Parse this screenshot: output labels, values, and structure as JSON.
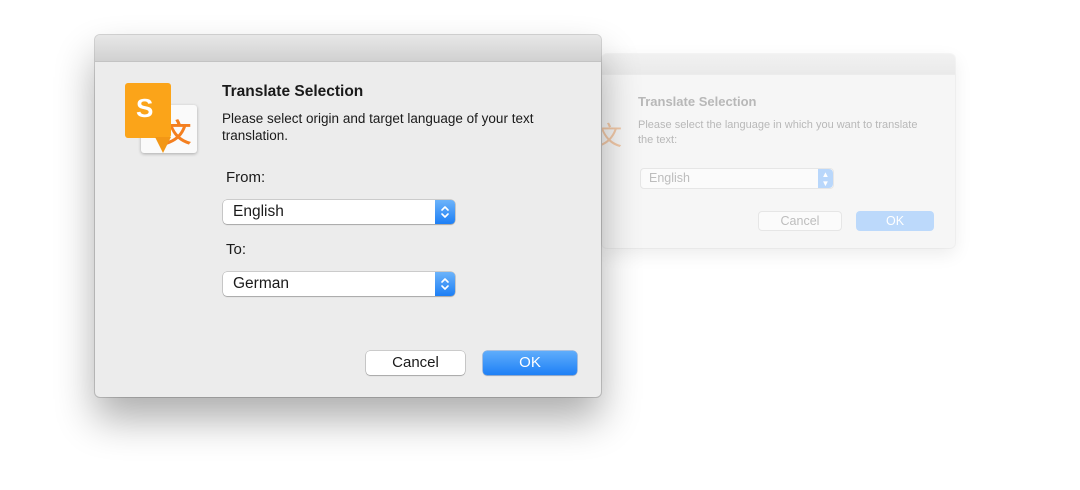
{
  "main_dialog": {
    "title": "Translate Selection",
    "description": "Please select origin and target language of your text translation.",
    "from_label": "From:",
    "from_value": "English",
    "to_label": "To:",
    "to_value": "German",
    "cancel_label": "Cancel",
    "ok_label": "OK",
    "icon": {
      "name": "translate-app-icon",
      "front_glyph": "S",
      "back_glyph": "文",
      "front_color": "#fba419",
      "back_glyph_color": "#f47f1f"
    },
    "accent_color": "#1e80f6"
  },
  "background_dialog": {
    "title": "Translate Selection",
    "description": "Please select the language in which you want to translate the text:",
    "language_value": "English",
    "cancel_label": "Cancel",
    "ok_label": "OK"
  }
}
